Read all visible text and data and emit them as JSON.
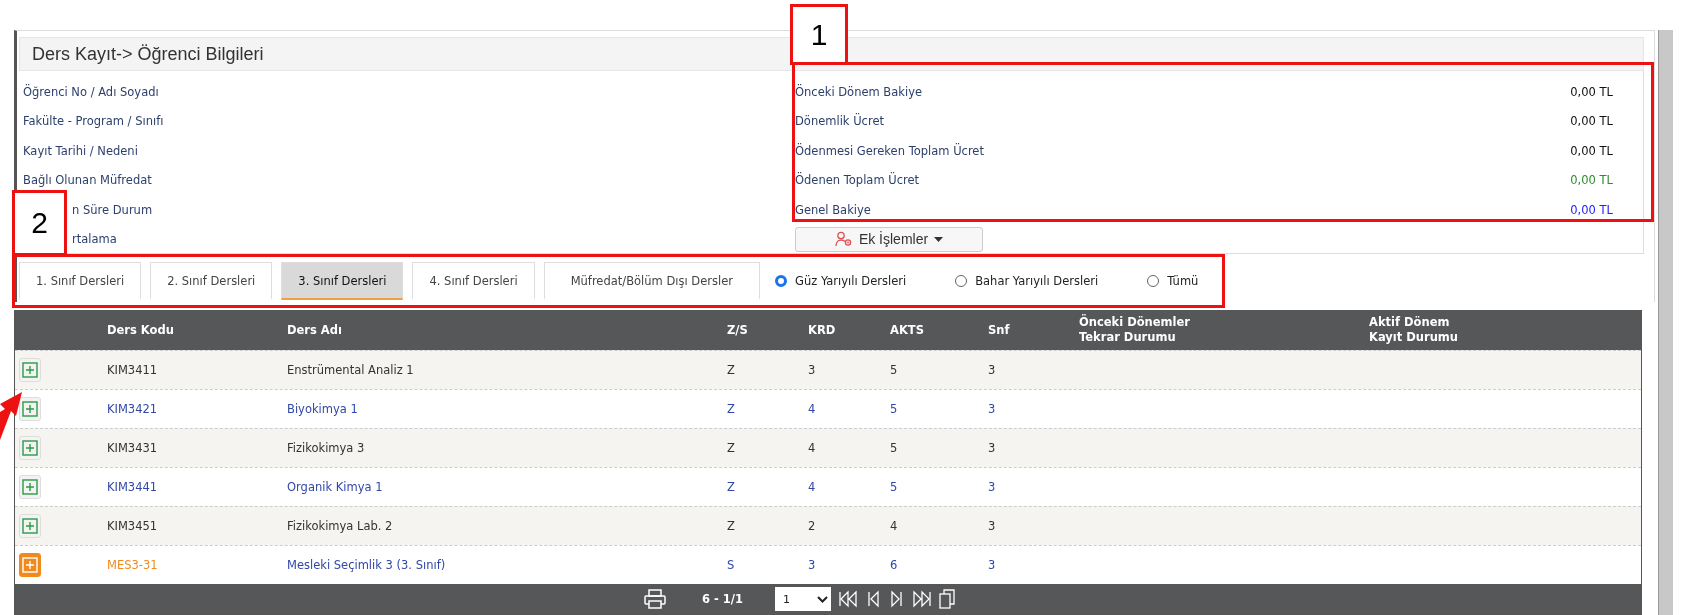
{
  "title": "Ders Kayıt->  Öğrenci Bilgileri",
  "student_fields": [
    "Öğrenci No / Adı Soyadı",
    "Fakülte - Program / Sınıfı",
    "Kayıt Tarihi / Nedeni",
    "Bağlı Olunan Müfredat",
    "n Süre Durum",
    "rtalama"
  ],
  "balances": [
    {
      "label": "Önceki Dönem Bakiye",
      "value": "0,00 TL",
      "color": "#111111"
    },
    {
      "label": "Dönemlik Ücret",
      "value": "0,00 TL",
      "color": "#111111"
    },
    {
      "label": "Ödenmesi Gereken Toplam Ücret",
      "value": "0,00 TL",
      "color": "#111111"
    },
    {
      "label": "Ödenen Toplam Ücret",
      "value": "0,00 TL",
      "color": "#2e8b2e"
    },
    {
      "label": "Genel Bakiye",
      "value": "0,00 TL",
      "color": "#2323ff"
    }
  ],
  "actions_button": "Ek İşlemler",
  "tabs": [
    {
      "label": "1. Sınıf Dersleri",
      "selected": false
    },
    {
      "label": "2. Sınıf Dersleri",
      "selected": false
    },
    {
      "label": "3. Sınıf Dersleri",
      "selected": true
    },
    {
      "label": "4. Sınıf Dersleri",
      "selected": false
    },
    {
      "label": "Müfredat/Bölüm Dışı Dersler",
      "selected": false
    }
  ],
  "semester_filter": [
    {
      "label": "Güz Yarıyılı Dersleri",
      "selected": true
    },
    {
      "label": "Bahar Yarıyılı Dersleri",
      "selected": false
    },
    {
      "label": "Tümü",
      "selected": false
    }
  ],
  "table": {
    "columns": [
      "Ders Kodu",
      "Ders Adı",
      "Z/S",
      "KRD",
      "AKTS",
      "Snf",
      "Önceki Dönemler\nTekrar Durumu",
      "Aktif Dönem\nKayıt Durumu"
    ],
    "rows": [
      {
        "kind": "plain",
        "cells": [
          "KIM3411",
          "Enstrümental Analiz 1",
          "Z",
          "3",
          "5",
          "3"
        ]
      },
      {
        "kind": "link",
        "cells": [
          "KIM3421",
          "Biyokimya 1",
          "Z",
          "4",
          "5",
          "3"
        ]
      },
      {
        "kind": "plain",
        "cells": [
          "KIM3431",
          "Fizikokimya 3",
          "Z",
          "4",
          "5",
          "3"
        ]
      },
      {
        "kind": "link",
        "cells": [
          "KIM3441",
          "Organik Kimya 1",
          "Z",
          "4",
          "5",
          "3"
        ]
      },
      {
        "kind": "plain",
        "cells": [
          "KIM3451",
          "Fizikokimya Lab. 2",
          "Z",
          "2",
          "4",
          "3"
        ]
      },
      {
        "kind": "elective",
        "cells": [
          "MES3-31",
          "Mesleki Seçimlik 3 (3. Sınıf)",
          "S",
          "3",
          "6",
          "3"
        ]
      }
    ]
  },
  "pager": {
    "summary": "6 - 1/1",
    "page": "1"
  },
  "annotations": [
    {
      "label": "1"
    },
    {
      "label": "2"
    }
  ]
}
